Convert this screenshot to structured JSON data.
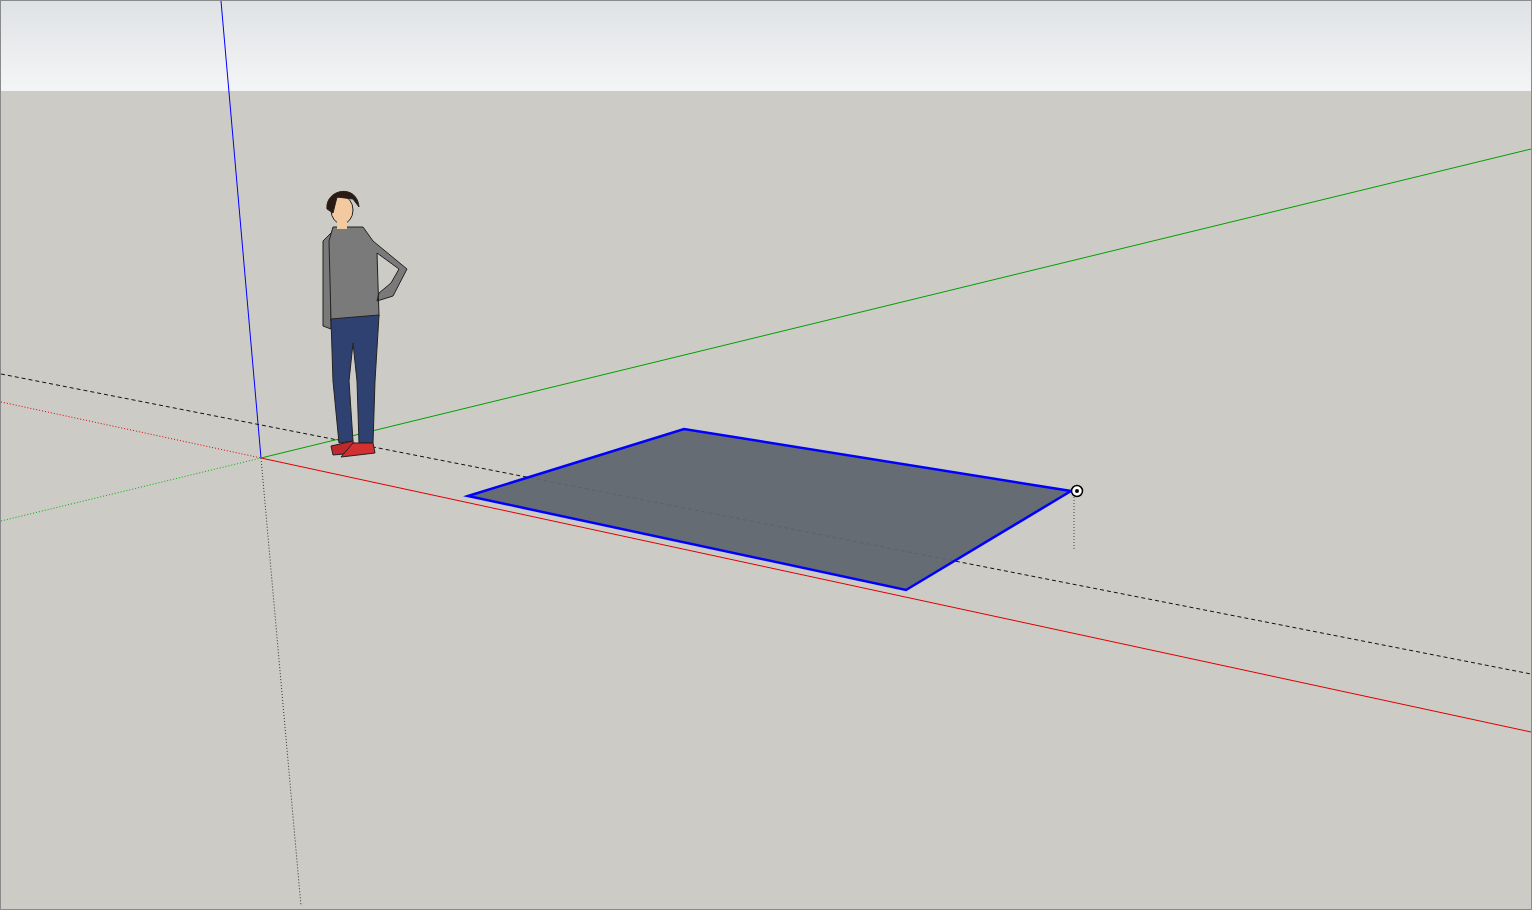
{
  "scene": {
    "rectangle": {
      "selected": true
    }
  }
}
